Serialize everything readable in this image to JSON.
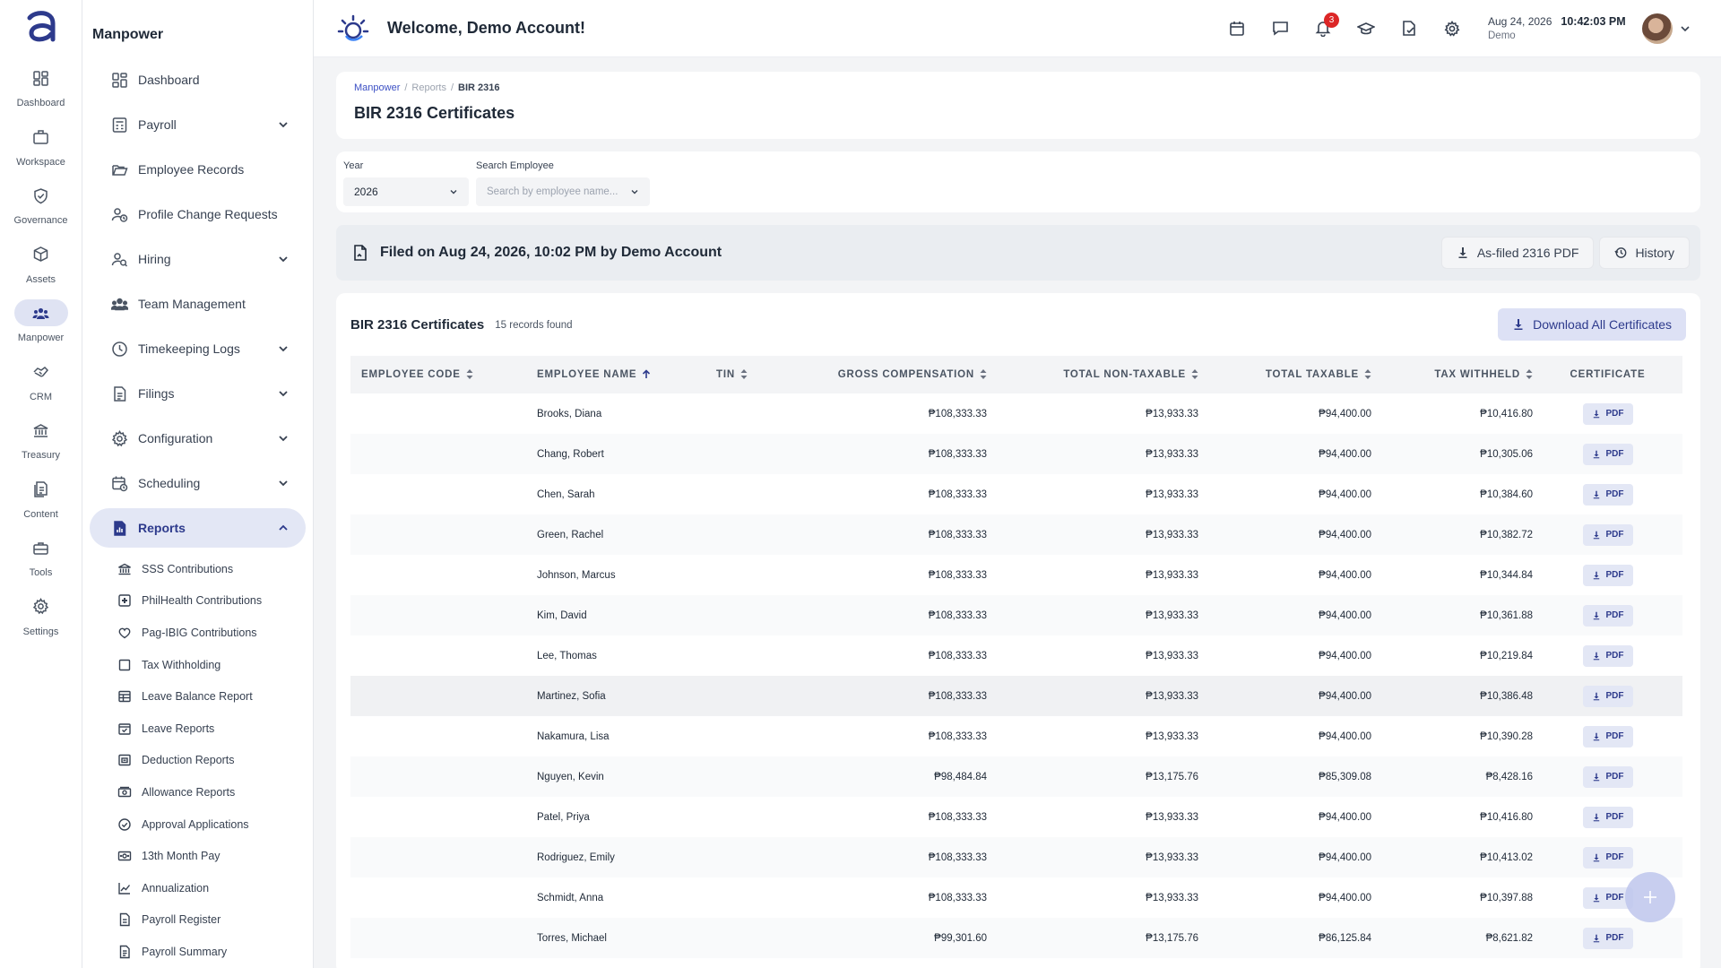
{
  "rail": {
    "items": [
      {
        "label": "Dashboard",
        "icon": "grid-icon"
      },
      {
        "label": "Workspace",
        "icon": "briefcase-icon"
      },
      {
        "label": "Governance",
        "icon": "shield-check-icon"
      },
      {
        "label": "Assets",
        "icon": "cube-icon"
      },
      {
        "label": "Manpower",
        "icon": "people-icon"
      },
      {
        "label": "CRM",
        "icon": "handshake-icon"
      },
      {
        "label": "Treasury",
        "icon": "bank-icon"
      },
      {
        "label": "Content",
        "icon": "document-stack-icon"
      },
      {
        "label": "Tools",
        "icon": "toolbox-icon"
      },
      {
        "label": "Settings",
        "icon": "gear-icon"
      }
    ]
  },
  "sidebar": {
    "title": "Manpower",
    "items": [
      {
        "label": "Dashboard"
      },
      {
        "label": "Payroll"
      },
      {
        "label": "Employee Records"
      },
      {
        "label": "Profile Change Requests"
      },
      {
        "label": "Hiring"
      },
      {
        "label": "Team Management"
      },
      {
        "label": "Timekeeping Logs"
      },
      {
        "label": "Filings"
      },
      {
        "label": "Configuration"
      },
      {
        "label": "Scheduling"
      },
      {
        "label": "Reports"
      }
    ],
    "report_items": [
      {
        "label": "SSS Contributions"
      },
      {
        "label": "PhilHealth Contributions"
      },
      {
        "label": "Pag-IBIG Contributions"
      },
      {
        "label": "Tax Withholding"
      },
      {
        "label": "Leave Balance Report"
      },
      {
        "label": "Leave Reports"
      },
      {
        "label": "Deduction Reports"
      },
      {
        "label": "Allowance Reports"
      },
      {
        "label": "Approval Applications"
      },
      {
        "label": "13th Month Pay"
      },
      {
        "label": "Annualization"
      },
      {
        "label": "Payroll Register"
      },
      {
        "label": "Payroll Summary"
      }
    ]
  },
  "topbar": {
    "welcome": "Welcome, Demo Account!",
    "notification_count": "3",
    "date": "Aug 24, 2026",
    "time": "10:42:03 PM",
    "account": "Demo"
  },
  "breadcrumb": {
    "c1": "Manpower",
    "c2": "Reports",
    "c3": "BIR 2316"
  },
  "page_title": "BIR 2316 Certificates",
  "filters": {
    "year_label": "Year",
    "year_value": "2026",
    "employee_label": "Search Employee",
    "employee_placeholder": "Search by employee name..."
  },
  "filed_bar": {
    "text": "Filed on Aug 24, 2026, 10:02 PM by Demo Account",
    "pdf_button": "As-filed 2316 PDF",
    "history_button": "History"
  },
  "table_card": {
    "title": "BIR 2316 Certificates",
    "count": "15 records found",
    "download_all": "Download All Certificates",
    "columns": [
      "EMPLOYEE CODE",
      "EMPLOYEE NAME",
      "TIN",
      "GROSS COMPENSATION",
      "TOTAL NON-TAXABLE",
      "TOTAL TAXABLE",
      "TAX WITHHELD",
      "CERTIFICATE"
    ],
    "pdf_label": "PDF",
    "rows": [
      {
        "code": "",
        "name": "Brooks, Diana",
        "tin": "",
        "gross": "₱108,333.33",
        "nontax": "₱13,933.33",
        "taxable": "₱94,400.00",
        "withheld": "₱10,416.80"
      },
      {
        "code": "",
        "name": "Chang, Robert",
        "tin": "",
        "gross": "₱108,333.33",
        "nontax": "₱13,933.33",
        "taxable": "₱94,400.00",
        "withheld": "₱10,305.06"
      },
      {
        "code": "",
        "name": "Chen, Sarah",
        "tin": "",
        "gross": "₱108,333.33",
        "nontax": "₱13,933.33",
        "taxable": "₱94,400.00",
        "withheld": "₱10,384.60"
      },
      {
        "code": "",
        "name": "Green, Rachel",
        "tin": "",
        "gross": "₱108,333.33",
        "nontax": "₱13,933.33",
        "taxable": "₱94,400.00",
        "withheld": "₱10,382.72"
      },
      {
        "code": "",
        "name": "Johnson, Marcus",
        "tin": "",
        "gross": "₱108,333.33",
        "nontax": "₱13,933.33",
        "taxable": "₱94,400.00",
        "withheld": "₱10,344.84"
      },
      {
        "code": "",
        "name": "Kim, David",
        "tin": "",
        "gross": "₱108,333.33",
        "nontax": "₱13,933.33",
        "taxable": "₱94,400.00",
        "withheld": "₱10,361.88"
      },
      {
        "code": "",
        "name": "Lee, Thomas",
        "tin": "",
        "gross": "₱108,333.33",
        "nontax": "₱13,933.33",
        "taxable": "₱94,400.00",
        "withheld": "₱10,219.84"
      },
      {
        "code": "",
        "name": "Martinez, Sofia",
        "tin": "",
        "gross": "₱108,333.33",
        "nontax": "₱13,933.33",
        "taxable": "₱94,400.00",
        "withheld": "₱10,386.48"
      },
      {
        "code": "",
        "name": "Nakamura, Lisa",
        "tin": "",
        "gross": "₱108,333.33",
        "nontax": "₱13,933.33",
        "taxable": "₱94,400.00",
        "withheld": "₱10,390.28"
      },
      {
        "code": "",
        "name": "Nguyen, Kevin",
        "tin": "",
        "gross": "₱98,484.84",
        "nontax": "₱13,175.76",
        "taxable": "₱85,309.08",
        "withheld": "₱8,428.16"
      },
      {
        "code": "",
        "name": "Patel, Priya",
        "tin": "",
        "gross": "₱108,333.33",
        "nontax": "₱13,933.33",
        "taxable": "₱94,400.00",
        "withheld": "₱10,416.80"
      },
      {
        "code": "",
        "name": "Rodriguez, Emily",
        "tin": "",
        "gross": "₱108,333.33",
        "nontax": "₱13,933.33",
        "taxable": "₱94,400.00",
        "withheld": "₱10,413.02"
      },
      {
        "code": "",
        "name": "Schmidt, Anna",
        "tin": "",
        "gross": "₱108,333.33",
        "nontax": "₱13,933.33",
        "taxable": "₱94,400.00",
        "withheld": "₱10,397.88"
      },
      {
        "code": "",
        "name": "Torres, Michael",
        "tin": "",
        "gross": "₱99,301.60",
        "nontax": "₱13,175.76",
        "taxable": "₱86,125.84",
        "withheld": "₱8,621.82"
      }
    ]
  },
  "colors": {
    "accent": "#2d3a8c",
    "accent_light": "#e3e7f5",
    "badge": "#dc2626"
  }
}
